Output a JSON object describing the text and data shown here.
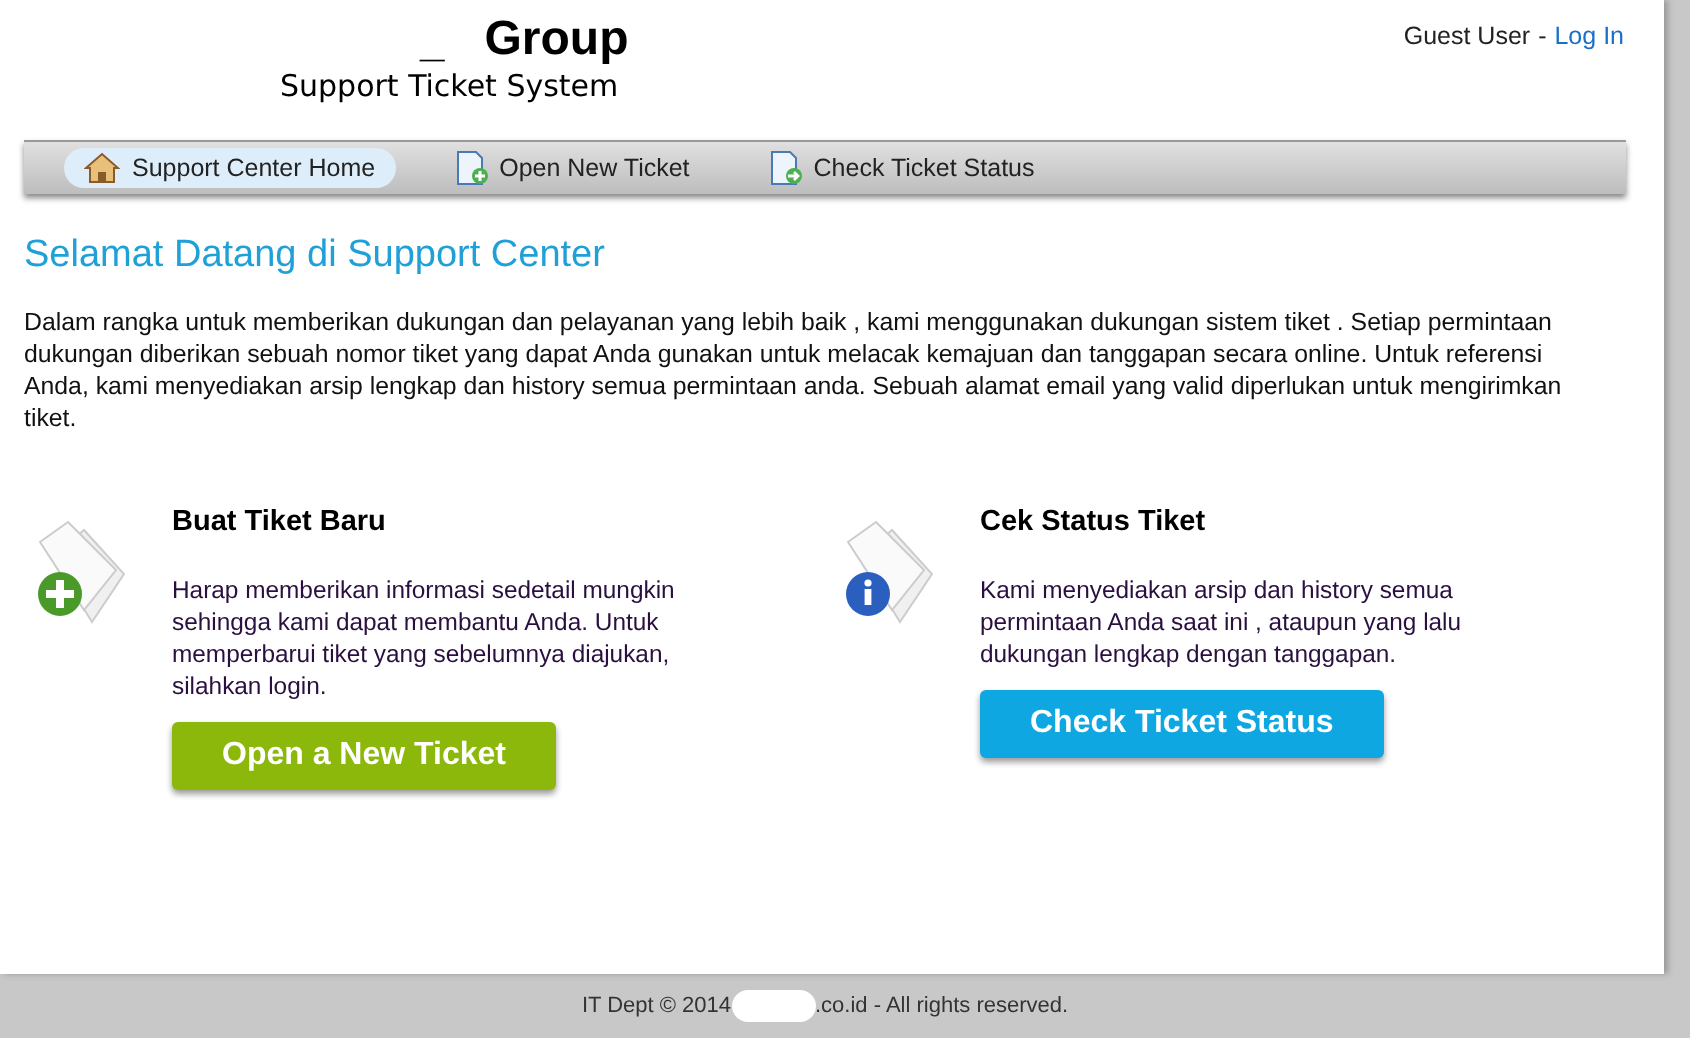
{
  "header": {
    "logo_mark": "_",
    "logo_title": "Group",
    "logo_subtitle": "Support Ticket System",
    "user": "Guest User",
    "separator": "-",
    "login_link": "Log In"
  },
  "nav": [
    {
      "label": "Support Center Home",
      "kind": "home",
      "selected": true
    },
    {
      "label": "Open New Ticket",
      "kind": "new",
      "selected": false
    },
    {
      "label": "Check Ticket Status",
      "kind": "status",
      "selected": false
    }
  ],
  "welcome": {
    "title": "Selamat Datang di Support Center",
    "text": "Dalam rangka untuk memberikan dukungan dan pelayanan yang lebih baik , kami menggunakan dukungan sistem tiket . Setiap permintaan dukungan diberikan sebuah nomor tiket yang dapat Anda gunakan untuk melacak kemajuan dan tanggapan secara online. Untuk referensi Anda, kami menyediakan arsip lengkap dan history semua permintaan anda. Sebuah alamat email yang valid diperlukan untuk mengirimkan tiket."
  },
  "cards": [
    {
      "kind": "new",
      "title": "Buat Tiket Baru",
      "text": "Harap memberikan informasi sedetail mungkin sehingga kami dapat membantu Anda. Untuk memperbarui tiket yang sebelumnya diajukan, silahkan login.",
      "button": "Open a New Ticket"
    },
    {
      "kind": "status",
      "title": "Cek Status Tiket",
      "text": "Kami menyediakan arsip dan history semua permintaan Anda saat ini , ataupun yang lalu dukungan lengkap dengan tanggapan.",
      "button": "Check Ticket Status"
    }
  ],
  "footer": {
    "before": "IT Dept © 2014",
    "after": ".co.id - All rights reserved."
  }
}
